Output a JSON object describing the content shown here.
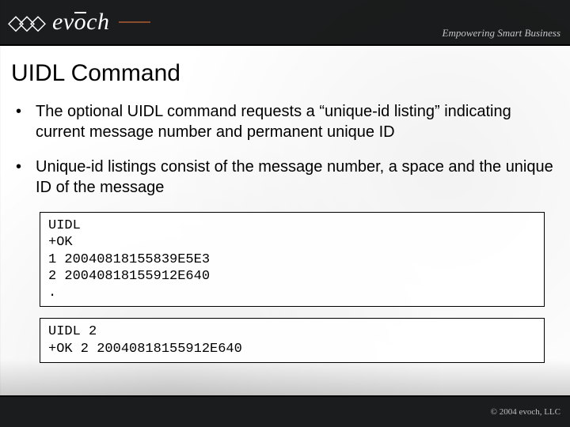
{
  "brand": {
    "name": "evōch",
    "tagline": "Empowering Smart Business"
  },
  "slide": {
    "title": "UIDL Command",
    "bullets": [
      "The optional UIDL command requests a “unique-id listing” indicating current message number and permanent unique ID",
      "Unique-id listings consist of the message number, a space and the unique ID of the message"
    ],
    "code1": "UIDL\n+OK\n1 20040818155839E5E3\n2 20040818155912E640\n.",
    "code2": "UIDL 2\n+OK 2 20040818155912E640"
  },
  "footer": {
    "copyright": "© 2004 evoch, LLC"
  }
}
